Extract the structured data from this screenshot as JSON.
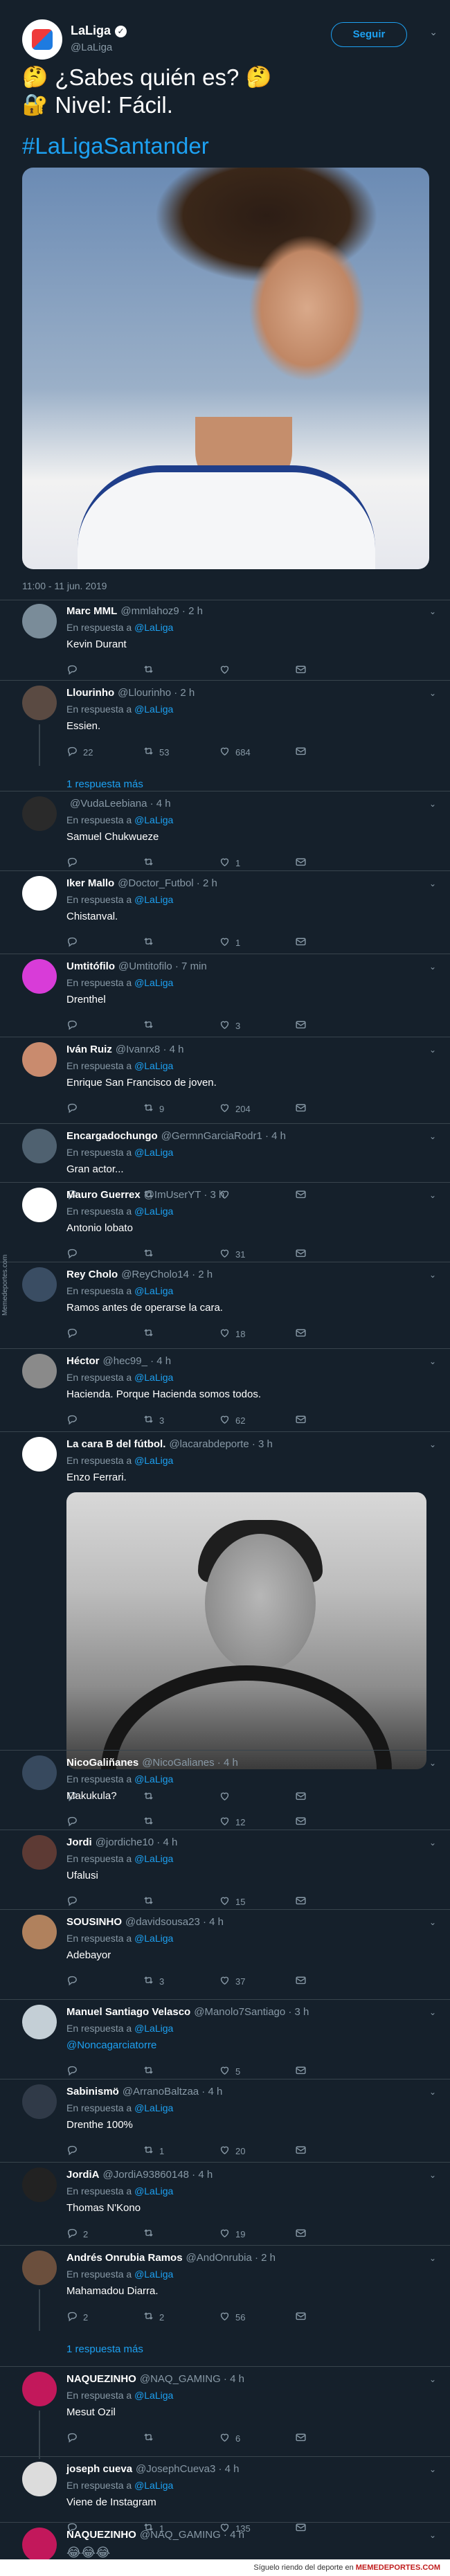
{
  "main": {
    "name": "LaLiga",
    "handle": "@LaLiga",
    "follow_label": "Seguir",
    "line1_text": "¿Sabes quién es?",
    "line2_text": "Nivel: Fácil.",
    "hashtag": "#LaLigaSantander",
    "timestamp": "11:00 - 11 jun. 2019"
  },
  "in_reply_prefix": "En respuesta a",
  "in_reply_mention": "@LaLiga",
  "replies": [
    {
      "name": "Marc MML",
      "handle": "@mmlahoz9 · 2 h",
      "text": "Kevin Durant",
      "reply": "",
      "rt": "",
      "like": ""
    },
    {
      "name": "Llourinho",
      "handle": "@Llourinho · 2 h",
      "text": "Essien.",
      "reply": "22",
      "rt": "53",
      "like": "684",
      "more": "1 respuesta más"
    },
    {
      "name": "",
      "handle": "@VudaLeebiana · 4 h",
      "text": "Samuel Chukwueze",
      "reply": "",
      "rt": "",
      "like": "1"
    },
    {
      "name": "Iker Mallo",
      "handle": "@Doctor_Futbol · 2 h",
      "text": "Chistanval.",
      "reply": "",
      "rt": "",
      "like": "1"
    },
    {
      "name": "Umtitófilo",
      "handle": "@Umtitofilo · 7 min",
      "text": "Drenthel",
      "reply": "",
      "rt": "",
      "like": "3"
    },
    {
      "name": "Iván Ruiz",
      "handle": "@Ivanrx8 · 4 h",
      "text": "Enrique San Francisco de joven.",
      "reply": "",
      "rt": "9",
      "like": "204"
    },
    {
      "name": "Encargadochungo",
      "handle": "@GermnGarciaRodr1 · 4 h",
      "text": "Gran actor...",
      "reply": "",
      "rt": "",
      "like": ""
    },
    {
      "name": "Mauro Guerrex",
      "handle": "@ImUserYT · 3 h",
      "text": "Antonio lobato",
      "reply": "",
      "rt": "",
      "like": "31"
    },
    {
      "name": "Rey Cholo",
      "handle": "@ReyCholo14 · 2 h",
      "text": "Ramos antes de operarse la cara.",
      "reply": "",
      "rt": "",
      "like": "18"
    },
    {
      "name": "Héctor",
      "handle": "@hec99_ · 4 h",
      "text": "Hacienda. Porque Hacienda somos todos.",
      "reply": "",
      "rt": "3",
      "like": "62"
    },
    {
      "name": "La cara B del fútbol.",
      "handle": "@lacarabdeporte · 3 h",
      "text": "Enzo Ferrari.",
      "reply": "",
      "rt": "",
      "like": ""
    },
    {
      "name": "NicoGaliñanes",
      "handle": "@NicoGalianes · 4 h",
      "text": "Makukula?",
      "reply": "",
      "rt": "",
      "like": "12"
    },
    {
      "name": "Jordi",
      "handle": "@jordiche10 · 4 h",
      "text": "Ufalusi",
      "reply": "",
      "rt": "",
      "like": "15"
    },
    {
      "name": "SOUSINHO",
      "handle": "@davidsousa23 · 4 h",
      "text": "Adebayor",
      "reply": "",
      "rt": "3",
      "like": "37"
    },
    {
      "name": "Manuel Santiago Velasco",
      "handle": "@Manolo7Santiago · 3 h",
      "text": "@Noncagarciatorre",
      "reply": "",
      "rt": "",
      "like": "5"
    },
    {
      "name": "Sabinismö",
      "handle": "@ArranoBaltzaa · 4 h",
      "text": "Drenthe 100%",
      "reply": "",
      "rt": "1",
      "like": "20"
    },
    {
      "name": "JordiA",
      "handle": "@JordiA93860148 · 4 h",
      "text": "Thomas N'Kono",
      "reply": "2",
      "rt": "",
      "like": "19"
    },
    {
      "name": "Andrés Onrubia Ramos",
      "handle": "@AndOnrubia · 2 h",
      "text": "Mahamadou Diarra.",
      "reply": "2",
      "rt": "2",
      "like": "56",
      "more": "1 respuesta más"
    },
    {
      "name": "NAQUEZINHO",
      "handle": "@NAQ_GAMING · 4 h",
      "text": "Mesut Ozil",
      "reply": "",
      "rt": "",
      "like": "6"
    },
    {
      "name": "joseph cueva",
      "handle": "@JosephCueva3 · 4 h",
      "text": "Viene de Instagram",
      "reply": "",
      "rt": "1",
      "like": "135"
    },
    {
      "name": "NAQUEZINHO",
      "handle": "@NAQ_GAMING · 4 h",
      "text": "",
      "reply": "",
      "rt": "",
      "like": ""
    }
  ],
  "footer": {
    "prefix": "Síguelo riendo del deporte en",
    "site": "MEMEDEPORTES.COM"
  },
  "side_watermark": "Memedeportes.com",
  "colors": {
    "bg": "#15202b",
    "accent": "#1da1f2",
    "muted": "#8899a6",
    "divider": "#38444d"
  }
}
